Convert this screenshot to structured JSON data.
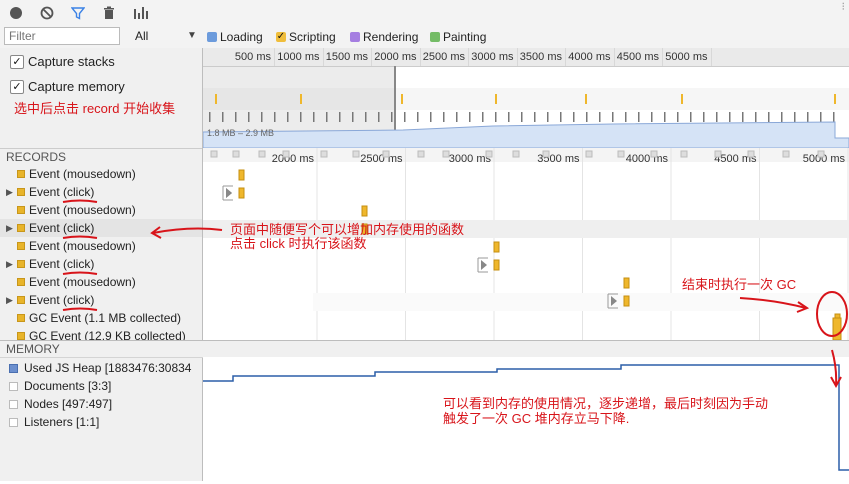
{
  "toolbar": {
    "icons": [
      "record-icon",
      "clear-icon",
      "filter-icon",
      "trash-icon",
      "bars-icon"
    ]
  },
  "filter": {
    "placeholder": "Filter",
    "value": "",
    "category": "All"
  },
  "legend": [
    {
      "label": "Loading",
      "color": "#6c9bdc",
      "checked": false
    },
    {
      "label": "Scripting",
      "color": "#f0be3c",
      "checked": true
    },
    {
      "label": "Rendering",
      "color": "#a57ee1",
      "checked": false
    },
    {
      "label": "Painting",
      "color": "#74bc66",
      "checked": false
    }
  ],
  "options": {
    "capture_stacks": "Capture stacks",
    "capture_memory": "Capture memory"
  },
  "overview": {
    "ticks": [
      "500 ms",
      "1000 ms",
      "1500 ms",
      "2000 ms",
      "2500 ms",
      "3000 ms",
      "3500 ms",
      "4000 ms",
      "4500 ms",
      "5000 ms"
    ],
    "heap_range": "1.8 MB – 2.9 MB"
  },
  "records": {
    "header": "RECORDS",
    "ticks": [
      "2000 ms",
      "2500 ms",
      "3000 ms",
      "3500 ms",
      "4000 ms",
      "4500 ms",
      "5000 ms"
    ],
    "items": [
      {
        "label": "Event (mousedown)",
        "expandable": false
      },
      {
        "label": "Event (click)",
        "expandable": true
      },
      {
        "label": "Event (mousedown)",
        "expandable": false
      },
      {
        "label": "Event (click)",
        "expandable": true
      },
      {
        "label": "Event (mousedown)",
        "expandable": false
      },
      {
        "label": "Event (click)",
        "expandable": true
      },
      {
        "label": "Event (mousedown)",
        "expandable": false
      },
      {
        "label": "Event (click)",
        "expandable": true
      },
      {
        "label": "GC Event (1.1 MB collected)",
        "expandable": false
      },
      {
        "label": "GC Event (12.9 KB collected)",
        "expandable": false
      }
    ]
  },
  "memory": {
    "header": "MEMORY",
    "counters": [
      {
        "label": "Used JS Heap [1883476:30834",
        "color": "#6c8fce",
        "checked": true
      },
      {
        "label": "Documents [3:3]",
        "color": "#d0d0d0",
        "checked": false
      },
      {
        "label": "Nodes [497:497]",
        "color": "#d0d0d0",
        "checked": false
      },
      {
        "label": "Listeners [1:1]",
        "color": "#d0d0d0",
        "checked": false
      }
    ]
  },
  "annotations": {
    "record_hint": "选中后点击 record 开始收集",
    "click_hint_1": "页面中随便写个可以增加内存使用的函数",
    "click_hint_2": "点击 click 时执行该函数",
    "gc_hint": "结束时执行一次 GC",
    "memory_hint_1": "可以看到内存的使用情况，逐步递增，最后时刻因为手动",
    "memory_hint_2": "触发了一次 GC 堆内存立马下降."
  }
}
